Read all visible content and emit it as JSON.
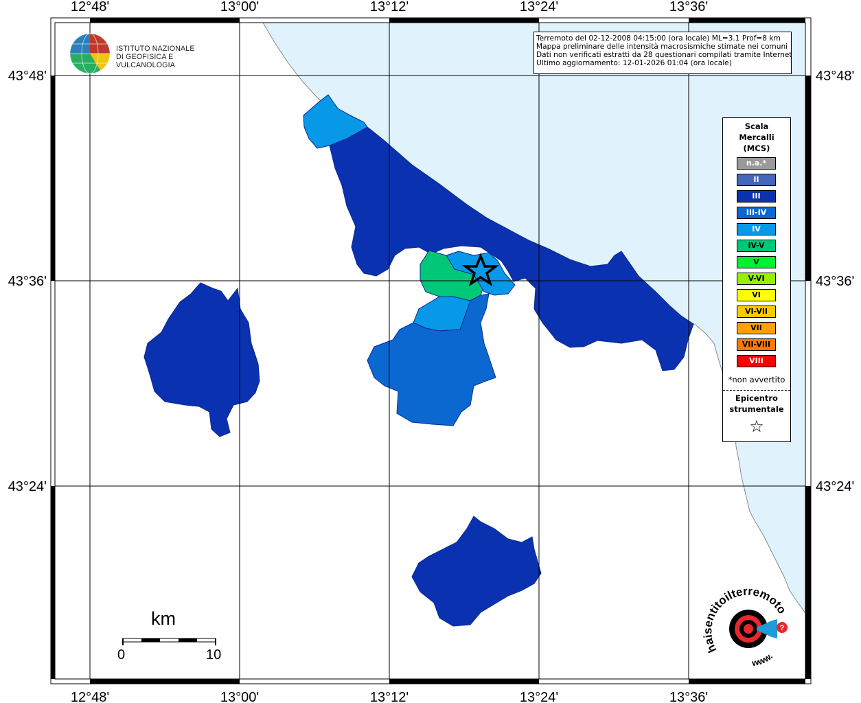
{
  "map": {
    "lon_labels": [
      "12°48'",
      "13°00'",
      "13°12'",
      "13°24'",
      "13°36'"
    ],
    "lat_labels": [
      "43°48'",
      "43°36'",
      "43°24'"
    ],
    "colors": {
      "sea": "#e0f3fd",
      "land": "#ffffff",
      "intensity_II": "#4466bb",
      "intensity_III": "#0a32b0",
      "intensity_III_IV": "#0b68d0",
      "intensity_IV": "#0798e8",
      "intensity_IV_V": "#00c878",
      "epicenter_outline": "#000000"
    }
  },
  "info_box": {
    "line1": "Terremoto del 02-12-2008 04:15:00 (ora locale) ML=3.1 Prof=8 km",
    "line2": "Mappa preliminare delle intensità macrosismiche stimate nei comuni",
    "line3": "Dati non verificati estratti da 28 questionari compilati tramite Internet.",
    "line4": "Ultimo aggiornamento: 12-01-2026 01:04 (ora locale)"
  },
  "logo": {
    "line1": "ISTITUTO NAZIONALE",
    "line2": "DI GEOFISICA E VULCANOLOGIA"
  },
  "legend": {
    "title_line1": "Scala",
    "title_line2": "Mercalli",
    "title_line3": "(MCS)",
    "items": [
      {
        "label": "n.a.*",
        "color": "#9a9a9a",
        "text_color": "#ffffff"
      },
      {
        "label": "II",
        "color": "#4466bb",
        "text_color": "#ffffff"
      },
      {
        "label": "III",
        "color": "#0a32b0",
        "text_color": "#ffffff"
      },
      {
        "label": "III-IV",
        "color": "#0b68d0",
        "text_color": "#ffffff"
      },
      {
        "label": "IV",
        "color": "#0798e8",
        "text_color": "#ffffff"
      },
      {
        "label": "IV-V",
        "color": "#00c878",
        "text_color": "#000000"
      },
      {
        "label": "V",
        "color": "#00f032",
        "text_color": "#000000"
      },
      {
        "label": "V-VI",
        "color": "#96f000",
        "text_color": "#000000"
      },
      {
        "label": "VI",
        "color": "#ffff00",
        "text_color": "#000000"
      },
      {
        "label": "VI-VII",
        "color": "#ffc800",
        "text_color": "#000000"
      },
      {
        "label": "VII",
        "color": "#ffa000",
        "text_color": "#000000"
      },
      {
        "label": "VII-VIII",
        "color": "#ff7800",
        "text_color": "#000000"
      },
      {
        "label": "VIII",
        "color": "#ff0000",
        "text_color": "#ffffff"
      }
    ],
    "note": "*non avvertito",
    "epicenter_line1": "Epicentro",
    "epicenter_line2": "strumentale",
    "epicenter_symbol": "☆"
  },
  "scale_bar": {
    "title": "km",
    "min_label": "0",
    "max_label": "10"
  },
  "hst_logo": {
    "text": "haisentitoilterremoto.it",
    "text2": "www."
  }
}
